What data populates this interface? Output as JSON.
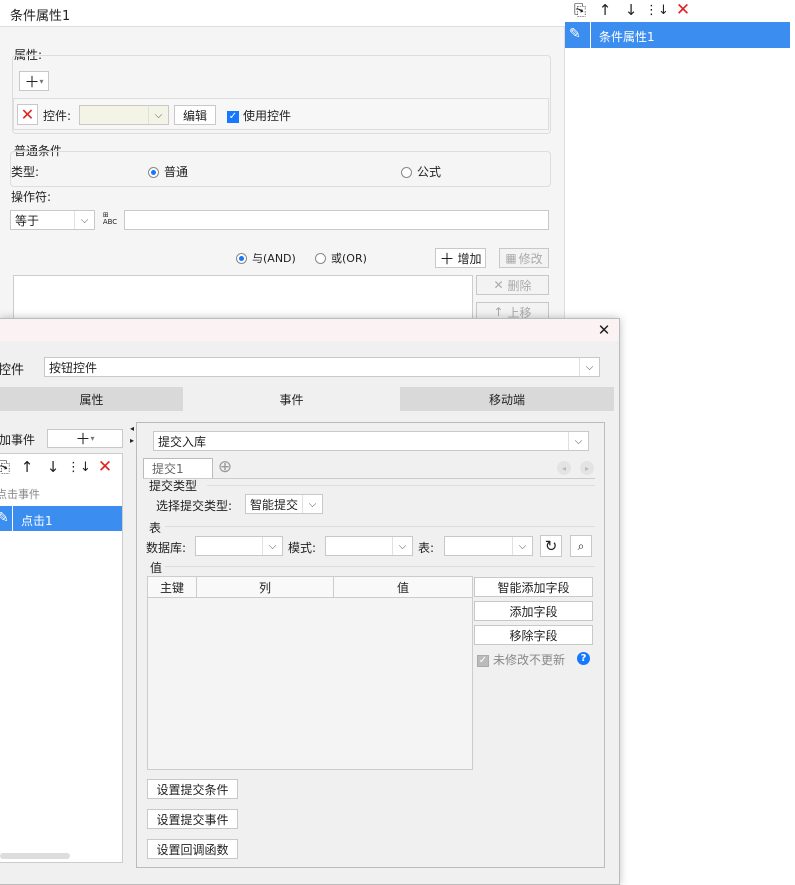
{
  "bg_panel": {
    "title": "条件属性1",
    "attr_label": "属性:",
    "ctrl_label": "控件:",
    "edit_label": "编辑",
    "use_ctrl_label": "使用控件",
    "normal_cond_label": "普通条件",
    "type_label": "类型:",
    "type_normal": "普通",
    "type_formula": "公式",
    "operator_label": "操作符:",
    "operator_value": "等于",
    "and_label": "与(AND)",
    "or_label": "或(OR)",
    "add_label": "增加",
    "modify_label": "修改",
    "delete_label": "删除",
    "up_label": "上移"
  },
  "right_panel": {
    "selected_item": "条件属性1"
  },
  "dialog": {
    "ctrl_label": "控件",
    "ctrl_value": "按钮控件",
    "tabs": [
      {
        "label": "属性"
      },
      {
        "label": "事件"
      },
      {
        "label": "移动端"
      }
    ],
    "add_event_label": "加事件",
    "event_group": "点击事件",
    "event_item": "点击1",
    "action_value": "提交入库",
    "submit_tab": "提交1",
    "submit_type_section": "提交类型",
    "choose_type_label": "选择提交类型:",
    "choose_type_value": "智能提交",
    "table_section": "表",
    "db_label": "数据库:",
    "schema_label": "模式:",
    "table_label": "表:",
    "value_section": "值",
    "columns": [
      "主键",
      "列",
      "值"
    ],
    "smart_add_label": "智能添加字段",
    "add_field_label": "添加字段",
    "remove_field_label": "移除字段",
    "no_update_label": "未修改不更新",
    "set_condition_label": "设置提交条件",
    "set_event_label": "设置提交事件",
    "set_callback_label": "设置回调函数"
  },
  "colors": {
    "accent": "#1677ff",
    "delete": "#e02020",
    "selected_bg": "#3b8ef0",
    "dialog_bg": "#f0f0f0",
    "tab_bg": "#d9d9d9"
  }
}
